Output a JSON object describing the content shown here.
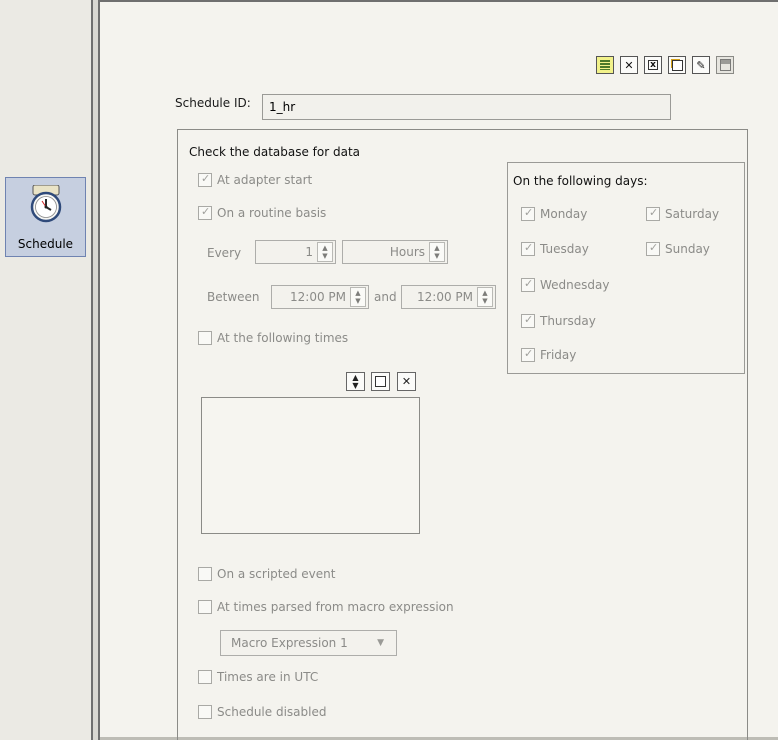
{
  "nav": {
    "schedule_label": "Schedule"
  },
  "toolbar": {
    "buttons": [
      {
        "icon": "list-icon"
      },
      {
        "icon": "delete-icon"
      },
      {
        "icon": "clear-icon"
      },
      {
        "icon": "new-icon"
      },
      {
        "icon": "edit-icon"
      },
      {
        "icon": "save-icon"
      }
    ]
  },
  "schedule_id": {
    "label": "Schedule ID:",
    "value": "1_hr"
  },
  "check_group": {
    "title": "Check the database for data",
    "at_adapter_start": {
      "label": "At adapter start",
      "checked": true
    },
    "routine_basis": {
      "label": "On a routine basis",
      "checked": true
    },
    "every": {
      "label": "Every",
      "value": "1",
      "unit": "Hours"
    },
    "between": {
      "label": "Between",
      "start": "12:00 PM",
      "and_label": "and",
      "end": "12:00 PM"
    },
    "following_times": {
      "label": "At the following times",
      "checked": false
    },
    "scripted_event": {
      "label": "On a scripted event",
      "checked": false
    },
    "macro_times": {
      "label": "At times parsed from macro expression",
      "checked": false
    },
    "macro_select": {
      "value": "Macro Expression 1"
    },
    "utc": {
      "label": "Times are  in UTC",
      "checked": false
    },
    "disabled": {
      "label": "Schedule disabled",
      "checked": false
    }
  },
  "days": {
    "title": "On the following days:",
    "monday": "Monday",
    "tuesday": "Tuesday",
    "wednesday": "Wednesday",
    "thursday": "Thursday",
    "friday": "Friday",
    "saturday": "Saturday",
    "sunday": "Sunday"
  },
  "colors": {
    "nav_selected": "#c6cfe0",
    "panel_bg": "#f4f3ee",
    "disabled_text": "#8b8b88"
  }
}
